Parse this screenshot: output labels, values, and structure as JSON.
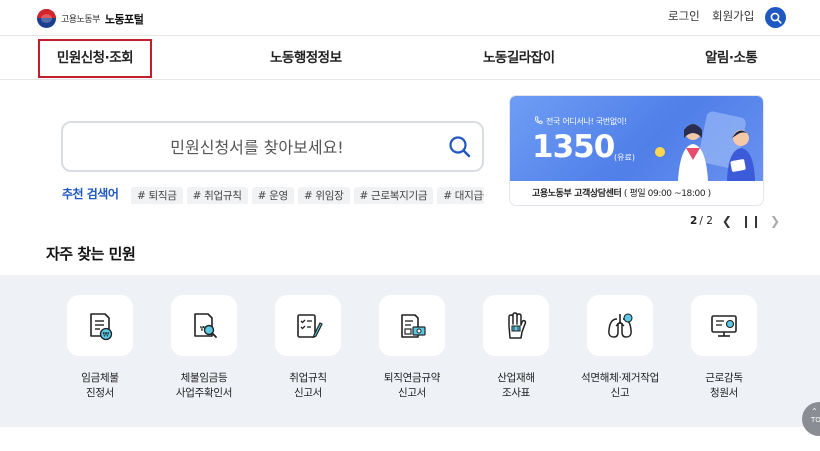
{
  "header": {
    "ministry": "고용노동부",
    "portal": "노동포털",
    "login": "로그인",
    "join": "회원가입"
  },
  "nav": [
    "민원신청·조회",
    "노동행정정보",
    "노동길라잡이",
    "알림·소통"
  ],
  "search": {
    "placeholder": "민원신청서를 찾아보세요!",
    "recommend_label": "추천 검색어",
    "keywords": [
      "# 퇴직금",
      "# 취업규칙",
      "# 운영",
      "# 위임장",
      "# 근로복지기금",
      "# 대지급금"
    ]
  },
  "banner": {
    "tagline": "전국 어디서나! 국번없이!",
    "number": "1350",
    "paid": "(유료)",
    "footer_bold": "고용노동부 고객상담센터",
    "footer_hours": "( 평일 09:00 ~18:00 )"
  },
  "pager": {
    "current": "2",
    "total": "/ 2"
  },
  "frequent": {
    "title": "자주 찾는 민원",
    "items": [
      {
        "line1": "임금체불",
        "line2": "진정서"
      },
      {
        "line1": "체불임금등",
        "line2": "사업주확인서"
      },
      {
        "line1": "취업규칙",
        "line2": "신고서"
      },
      {
        "line1": "퇴직연금규약",
        "line2": "신고서"
      },
      {
        "line1": "산업재해",
        "line2": "조사표"
      },
      {
        "line1": "석면해체·제거작업",
        "line2": "신고"
      },
      {
        "line1": "근로감독",
        "line2": "청원서"
      }
    ]
  },
  "top_label": "TOP",
  "colors": {
    "accent": "#1f57c3",
    "highlight_border": "#c0202a",
    "band": "#eef1f6"
  }
}
